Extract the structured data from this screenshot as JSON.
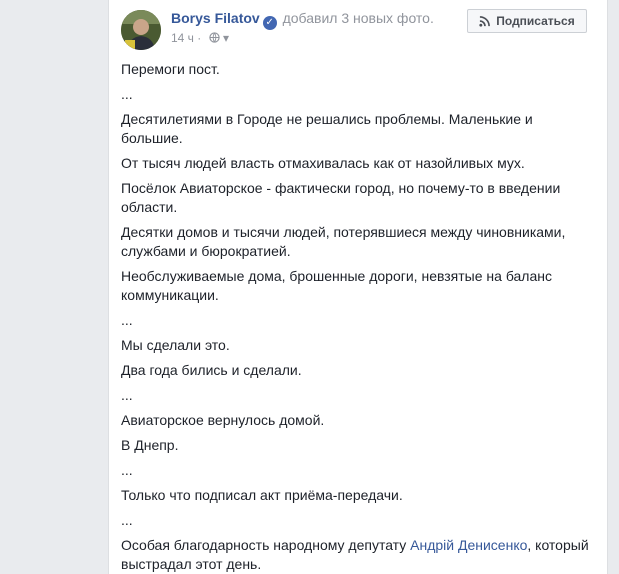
{
  "post": {
    "author": "Borys Filatov",
    "action": "добавил 3 новых фото.",
    "time": "14 ч",
    "subscribe_label": "Подписаться",
    "paragraphs": [
      "Перемоги пост.",
      "...",
      "Десятилетиями в Городе не решались проблемы. Маленькие и большие.",
      "От тысяч людей власть отмахивалась как от назойливых мух.",
      "Посёлок Авиаторское - фактически город, но почему-то в введении области.",
      "Десятки домов и тысячи людей, потерявшиеся между чиновниками, службами и бюрократией.",
      "Необслуживаемые дома, брошенные дороги, невзятые на баланс коммуникации.",
      "...",
      "Мы сделали это.",
      "Два года бились и сделали.",
      "...",
      "Авиаторское вернулось домой.",
      "В Днепр.",
      "...",
      "Только что подписал акт приёма-передачи.",
      "..."
    ],
    "last_paragraph": {
      "before": "Особая благодарность народному депутату ",
      "link": "Андрій Денисенко",
      "after": ", который выстрадал этот день."
    }
  },
  "icons": {
    "verified": "verified-badge-icon",
    "audience": "globe-icon",
    "subscribe": "rss-icon"
  },
  "colors": {
    "link": "#365899",
    "verified": "#4267b2",
    "meta": "#90949c"
  }
}
